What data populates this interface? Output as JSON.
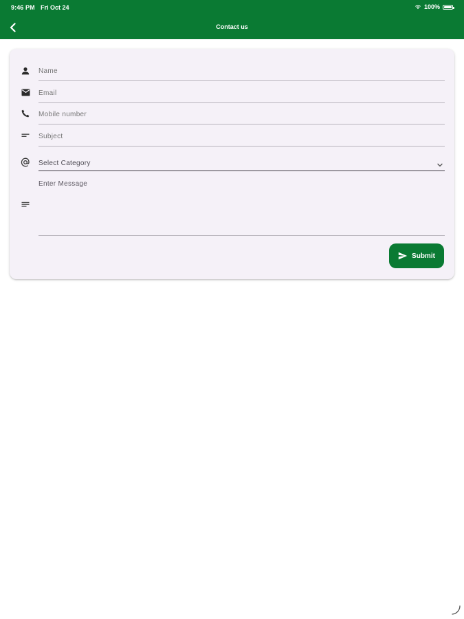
{
  "status_bar": {
    "time": "9:46 PM",
    "date": "Fri Oct 24",
    "battery": "100%"
  },
  "header": {
    "title": "Contact us",
    "back_icon": "chevron-left-icon"
  },
  "form": {
    "name": {
      "placeholder": "Name",
      "icon": "person-icon"
    },
    "email": {
      "placeholder": "Email",
      "icon": "envelope-icon"
    },
    "mobile": {
      "placeholder": "Mobile number",
      "icon": "phone-icon"
    },
    "subject": {
      "placeholder": "Subject",
      "icon": "short-text-icon"
    },
    "category": {
      "selected": "Select Category",
      "icon": "at-sign-icon"
    },
    "message": {
      "label": "Enter Message",
      "icon": "notes-icon"
    },
    "submit_label": "Submit"
  },
  "colors": {
    "brand": "#0a7a33",
    "card_bg": "#f5f1f8"
  }
}
